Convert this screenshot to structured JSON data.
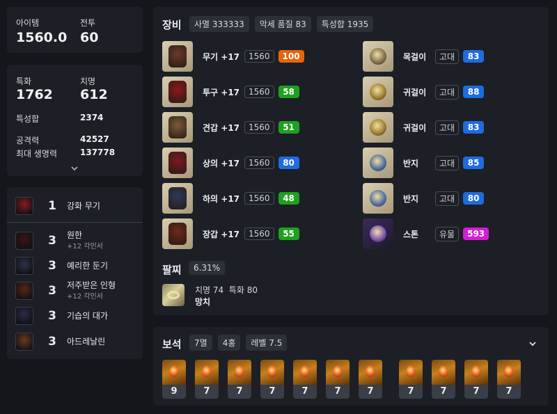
{
  "summary": {
    "item_label": "아이템",
    "item_value": "1560.0",
    "combat_label": "전투",
    "combat_value": "60"
  },
  "stats": {
    "crit_spec_label": "특화",
    "crit_spec_value": "1762",
    "crit_label": "치명",
    "crit_value": "612",
    "total_label": "특성합",
    "total_value": "2374",
    "atk_label": "공격력",
    "atk_value": "42527",
    "hp_label": "최대 생명력",
    "hp_value": "137778"
  },
  "engravings": [
    {
      "level": "1",
      "name": "강화 무기",
      "sub": "",
      "color": "#8a1a22"
    },
    {
      "level": "3",
      "name": "원한",
      "sub": "+12 각인서",
      "color": "#3a1414"
    },
    {
      "level": "3",
      "name": "예리한 둔기",
      "sub": "",
      "color": "#2a3444"
    },
    {
      "level": "3",
      "name": "저주받은 인형",
      "sub": "+12 각인서",
      "color": "#5a2418"
    },
    {
      "level": "3",
      "name": "기습의 대가",
      "sub": "",
      "color": "#2a2c48"
    },
    {
      "level": "3",
      "name": "아드레날린",
      "sub": "",
      "color": "#6a3a1c"
    }
  ],
  "equipment": {
    "title": "장비",
    "chips": [
      "사멸 333333",
      "악세 품질 83",
      "특성합 1935"
    ],
    "gear": [
      {
        "name": "무기 +17",
        "ilvl": "1560",
        "quality": "100",
        "qcolor": "#e8640c"
      },
      {
        "name": "투구 +17",
        "ilvl": "1560",
        "quality": "58",
        "qcolor": "#1fa01f"
      },
      {
        "name": "견갑 +17",
        "ilvl": "1560",
        "quality": "51",
        "qcolor": "#1fa01f"
      },
      {
        "name": "상의 +17",
        "ilvl": "1560",
        "quality": "80",
        "qcolor": "#1f6be0"
      },
      {
        "name": "하의 +17",
        "ilvl": "1560",
        "quality": "48",
        "qcolor": "#1fa01f"
      },
      {
        "name": "장갑 +17",
        "ilvl": "1560",
        "quality": "55",
        "qcolor": "#1fa01f"
      }
    ],
    "accessories": [
      {
        "name": "목걸이",
        "tier": "고대",
        "quality": "83",
        "qcolor": "#1f6be0"
      },
      {
        "name": "귀걸이",
        "tier": "고대",
        "quality": "88",
        "qcolor": "#1f6be0"
      },
      {
        "name": "귀걸이",
        "tier": "고대",
        "quality": "83",
        "qcolor": "#1f6be0"
      },
      {
        "name": "반지",
        "tier": "고대",
        "quality": "85",
        "qcolor": "#1f6be0"
      },
      {
        "name": "반지",
        "tier": "고대",
        "quality": "80",
        "qcolor": "#1f6be0"
      },
      {
        "name": "스톤",
        "tier": "유물",
        "quality": "593",
        "qcolor": "#d41fd4"
      }
    ]
  },
  "bracelet": {
    "title": "팔찌",
    "percent": "6.31%",
    "stats": "치명 74  특화 80",
    "effect": "망치"
  },
  "gems": {
    "title": "보석",
    "chips": [
      "7멸",
      "4홍",
      "레벨 7.5"
    ],
    "levels": [
      "9",
      "7",
      "7",
      "7",
      "7",
      "7",
      "7",
      "7",
      "7",
      "7",
      "7"
    ]
  },
  "icons": {
    "chevron": "chevron-down-icon"
  }
}
